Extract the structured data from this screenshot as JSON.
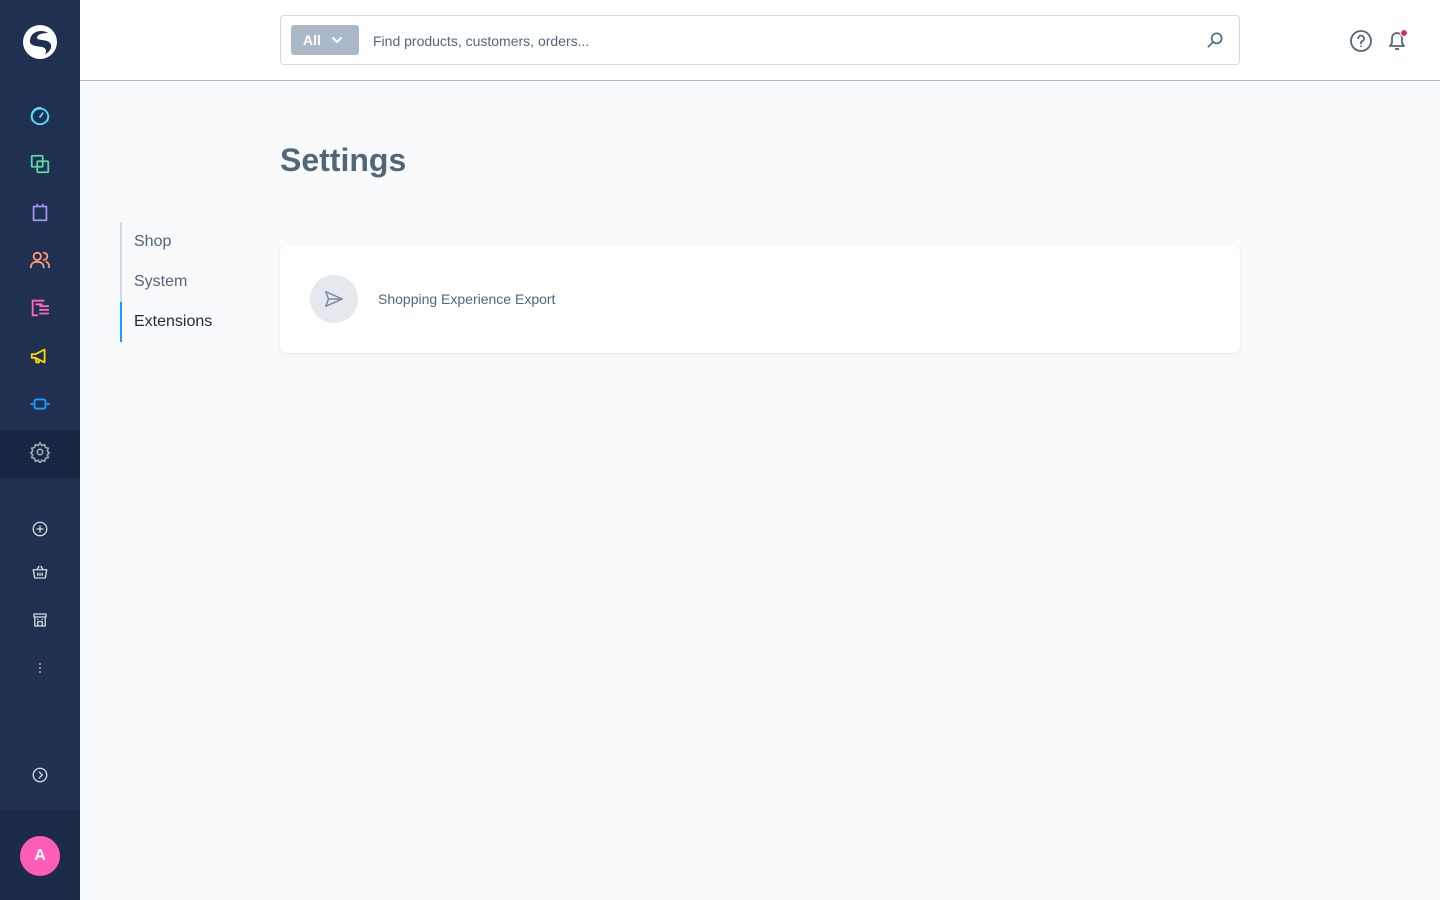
{
  "colors": {
    "rail_bg": "#1f3050",
    "accent": "#189eff",
    "avatar_bg": "#ff5db8",
    "notification_dot": "#de294c"
  },
  "rail": {
    "avatar_initial": "A",
    "main_items": [
      {
        "icon": "dashboard-icon",
        "color": "#57d9ff"
      },
      {
        "icon": "catalog-icon",
        "color": "#57d9a3"
      },
      {
        "icon": "orders-icon",
        "color": "#a092f0"
      },
      {
        "icon": "customers-icon",
        "color": "#ff9a72"
      },
      {
        "icon": "content-icon",
        "color": "#ff68b4"
      },
      {
        "icon": "marketing-icon",
        "color": "#ffd700"
      },
      {
        "icon": "extensions-icon",
        "color": "#189eff"
      },
      {
        "icon": "settings-icon",
        "color": "#9aa8b5"
      }
    ],
    "secondary_items": [
      {
        "icon": "add-sales-channel-icon"
      },
      {
        "icon": "headless-sales-channel-icon"
      },
      {
        "icon": "storefront-icon"
      },
      {
        "icon": "more-icon"
      }
    ],
    "collapse_icon": "chevron-circle-right-icon"
  },
  "search": {
    "type_label": "All",
    "placeholder": "Find products, customers, orders..."
  },
  "page": {
    "title": "Settings"
  },
  "subnav": {
    "items": [
      {
        "label": "Shop",
        "active": false
      },
      {
        "label": "System",
        "active": false
      },
      {
        "label": "Extensions",
        "active": true
      }
    ]
  },
  "card": {
    "items": [
      {
        "label": "Shopping Experience Export",
        "icon": "paper-plane-icon"
      }
    ]
  }
}
